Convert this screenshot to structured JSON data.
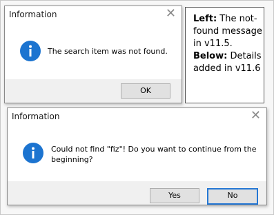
{
  "dialog_top": {
    "title": "Information",
    "close_glyph": "✕",
    "icon": "info-icon",
    "message": "The search item was not found.",
    "ok_label": "OK"
  },
  "note": {
    "left_bold": "Left:",
    "left_text": " The not-found message in v11.5.",
    "below_bold": "Below:",
    "below_text": " Details added in v11.6"
  },
  "dialog_bottom": {
    "title": "Information",
    "close_glyph": "✕",
    "icon": "info-icon",
    "message": "Could not find \"fiz\"! Do you want to continue from the beginning?",
    "yes_label": "Yes",
    "no_label": "No"
  },
  "colors": {
    "info_icon": "#1c74d0",
    "default_button_border": "#2477d4"
  }
}
